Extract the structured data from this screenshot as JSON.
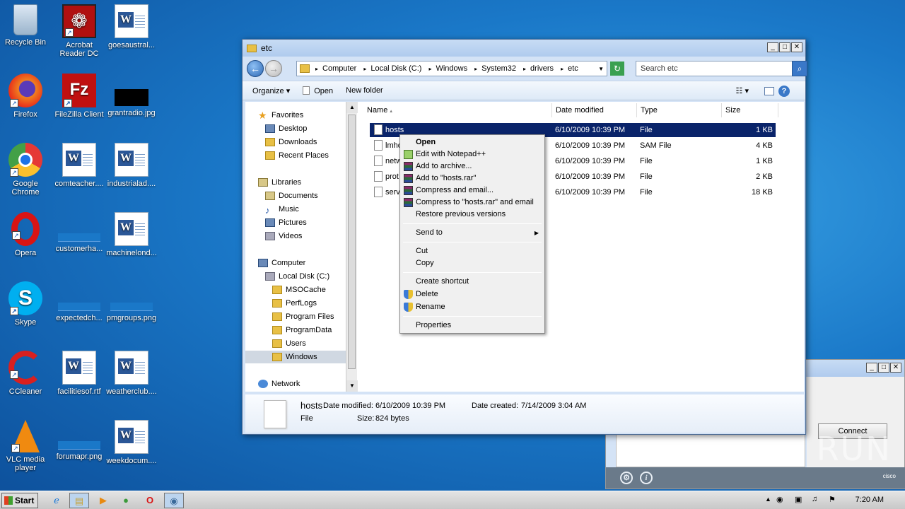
{
  "desktop": {
    "icons": [
      {
        "label": "Recycle Bin",
        "icon": "recycle-bin-icon"
      },
      {
        "label": "Acrobat Reader DC",
        "icon": "acrobat-icon"
      },
      {
        "label": "goesaustral...",
        "icon": "word-doc-icon"
      },
      {
        "label": "Firefox",
        "icon": "firefox-icon"
      },
      {
        "label": "FileZilla Client",
        "icon": "filezilla-icon"
      },
      {
        "label": "grantradio.jpg",
        "icon": "image-file-icon"
      },
      {
        "label": "Google Chrome",
        "icon": "chrome-icon"
      },
      {
        "label": "comteacher....",
        "icon": "word-doc-icon"
      },
      {
        "label": "industrialad....",
        "icon": "word-doc-icon"
      },
      {
        "label": "Opera",
        "icon": "opera-icon"
      },
      {
        "label": "customerha...",
        "icon": "blank-file-icon"
      },
      {
        "label": "machinelond...",
        "icon": "word-doc-icon"
      },
      {
        "label": "Skype",
        "icon": "skype-icon"
      },
      {
        "label": "expectedch...",
        "icon": "blank-file-icon"
      },
      {
        "label": "pmgroups.png",
        "icon": "blank-file-icon"
      },
      {
        "label": "CCleaner",
        "icon": "ccleaner-icon"
      },
      {
        "label": "facilitiesof.rtf",
        "icon": "word-doc-icon"
      },
      {
        "label": "weatherclub....",
        "icon": "word-doc-icon"
      },
      {
        "label": "VLC media player",
        "icon": "vlc-icon"
      },
      {
        "label": "forumapr.png",
        "icon": "blank-file-icon"
      },
      {
        "label": "weekdocum....",
        "icon": "word-doc-icon"
      }
    ]
  },
  "explorer": {
    "title": "etc",
    "breadcrumbs": [
      "Computer",
      "Local Disk (C:)",
      "Windows",
      "System32",
      "drivers",
      "etc"
    ],
    "search_placeholder": "Search etc",
    "toolbar": {
      "organize": "Organize",
      "open": "Open",
      "new_folder": "New folder"
    },
    "nav": {
      "favorites": "Favorites",
      "desktop": "Desktop",
      "downloads": "Downloads",
      "recent": "Recent Places",
      "libraries": "Libraries",
      "documents": "Documents",
      "music": "Music",
      "pictures": "Pictures",
      "videos": "Videos",
      "computer": "Computer",
      "local_disk": "Local Disk (C:)",
      "msocache": "MSOCache",
      "perflogs": "PerfLogs",
      "program_files": "Program Files",
      "programdata": "ProgramData",
      "users": "Users",
      "windows": "Windows",
      "network": "Network"
    },
    "columns": {
      "name": "Name",
      "date": "Date modified",
      "type": "Type",
      "size": "Size"
    },
    "files": [
      {
        "name": "hosts",
        "date": "6/10/2009 10:39 PM",
        "type": "File",
        "size": "1 KB"
      },
      {
        "name": "lmho",
        "date": "6/10/2009 10:39 PM",
        "type": "SAM File",
        "size": "4 KB"
      },
      {
        "name": "netw",
        "date": "6/10/2009 10:39 PM",
        "type": "File",
        "size": "1 KB"
      },
      {
        "name": "prot",
        "date": "6/10/2009 10:39 PM",
        "type": "File",
        "size": "2 KB"
      },
      {
        "name": "servi",
        "date": "6/10/2009 10:39 PM",
        "type": "File",
        "size": "18 KB"
      }
    ],
    "details": {
      "name": "hosts",
      "type": "File",
      "date_modified_label": "Date modified:",
      "date_modified": "6/10/2009 10:39 PM",
      "date_created_label": "Date created:",
      "date_created": "7/14/2009 3:04 AM",
      "size_label": "Size:",
      "size": "824 bytes"
    }
  },
  "context_menu": {
    "open": "Open",
    "edit_notepad": "Edit with Notepad++",
    "add_archive": "Add to archive...",
    "add_rar": "Add to \"hosts.rar\"",
    "compress_email": "Compress and email...",
    "compress_rar_email": "Compress to \"hosts.rar\" and email",
    "restore": "Restore previous versions",
    "send_to": "Send to",
    "cut": "Cut",
    "copy": "Copy",
    "create_shortcut": "Create shortcut",
    "delete": "Delete",
    "rename": "Rename",
    "properties": "Properties"
  },
  "dialog": {
    "connect": "Connect",
    "brand": "cisco"
  },
  "watermark": "ANY RUN",
  "taskbar": {
    "start": "Start",
    "clock": "7:20 AM"
  }
}
